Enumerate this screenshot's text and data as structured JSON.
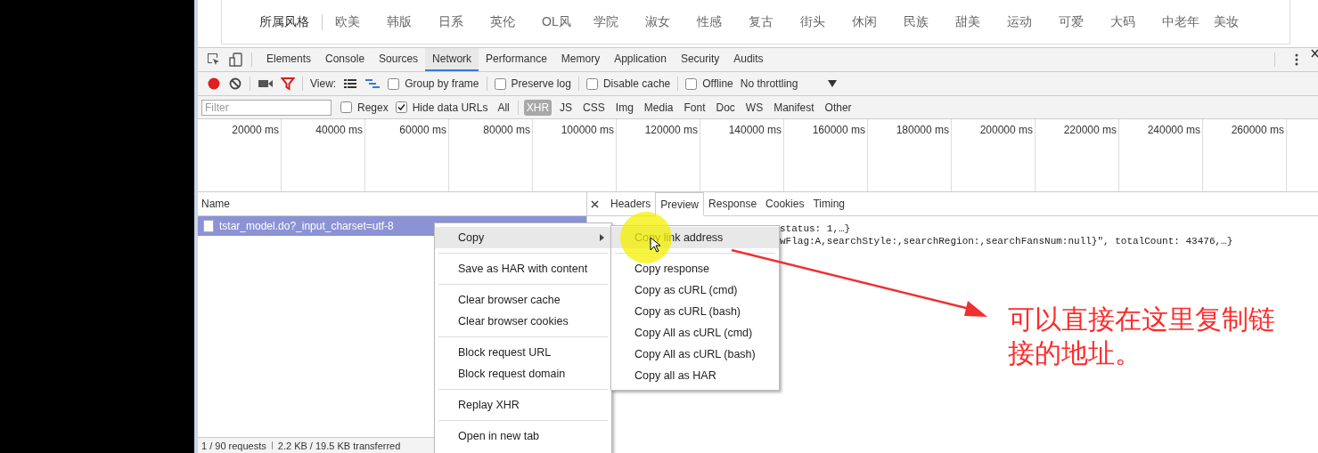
{
  "page_styles": {
    "label": "所属风格",
    "items": [
      "欧美",
      "韩版",
      "日系",
      "英伦",
      "OL风",
      "学院",
      "淑女",
      "性感",
      "复古",
      "街头",
      "休闲",
      "民族",
      "甜美",
      "运动",
      "可爱",
      "大码",
      "中老年",
      "美妆"
    ]
  },
  "devtools_tabs": [
    {
      "label": "Elements",
      "selected": false
    },
    {
      "label": "Console",
      "selected": false
    },
    {
      "label": "Sources",
      "selected": false
    },
    {
      "label": "Network",
      "selected": true
    },
    {
      "label": "Performance",
      "selected": false
    },
    {
      "label": "Memory",
      "selected": false
    },
    {
      "label": "Application",
      "selected": false
    },
    {
      "label": "Security",
      "selected": false
    },
    {
      "label": "Audits",
      "selected": false
    }
  ],
  "toolbar": {
    "recording": true,
    "view_label": "View:",
    "options": [
      {
        "label": "Group by frame",
        "checked": false
      },
      {
        "label": "Preserve log",
        "checked": false
      },
      {
        "label": "Disable cache",
        "checked": false
      },
      {
        "label": "Offline",
        "checked": false
      }
    ],
    "throttling": "No throttling"
  },
  "filter_bar": {
    "placeholder": "Filter",
    "regex": {
      "label": "Regex",
      "checked": false
    },
    "hide_data_urls": {
      "label": "Hide data URLs",
      "checked": true
    },
    "types": [
      {
        "label": "All",
        "selected": false
      },
      {
        "label": "XHR",
        "selected": true
      },
      {
        "label": "JS",
        "selected": false
      },
      {
        "label": "CSS",
        "selected": false
      },
      {
        "label": "Img",
        "selected": false
      },
      {
        "label": "Media",
        "selected": false
      },
      {
        "label": "Font",
        "selected": false
      },
      {
        "label": "Doc",
        "selected": false
      },
      {
        "label": "WS",
        "selected": false
      },
      {
        "label": "Manifest",
        "selected": false
      },
      {
        "label": "Other",
        "selected": false
      }
    ]
  },
  "timeline": {
    "ticks": [
      "20000 ms",
      "40000 ms",
      "60000 ms",
      "80000 ms",
      "100000 ms",
      "120000 ms",
      "140000 ms",
      "160000 ms",
      "180000 ms",
      "200000 ms",
      "220000 ms",
      "240000 ms",
      "260000 ms"
    ]
  },
  "requests": {
    "column": "Name",
    "rows": [
      {
        "name": "tstar_model.do?_input_charset=utf-8",
        "selected": true
      }
    ]
  },
  "status_bar": [
    "1 / 90 requests",
    "2.2 KB / 19.5 KB transferred"
  ],
  "detail_tabs": [
    {
      "label": "Headers",
      "selected": false
    },
    {
      "label": "Preview",
      "selected": true
    },
    {
      "label": "Response",
      "selected": false
    },
    {
      "label": "Cookies",
      "selected": false
    },
    {
      "label": "Timing",
      "selected": false
    }
  ],
  "preview_lines": [
    "status: 1,…}",
    "wFlag:A,searchStyle:,searchRegion:,searchFansNum:null}\", totalCount: 43476,…}"
  ],
  "context_menu": [
    [
      {
        "label": "Copy",
        "submenu": true,
        "highlighted": true
      }
    ],
    [
      {
        "label": "Save as HAR with content",
        "submenu": false,
        "highlighted": false
      }
    ],
    [
      {
        "label": "Clear browser cache",
        "submenu": false,
        "highlighted": false
      },
      {
        "label": "Clear browser cookies",
        "submenu": false,
        "highlighted": false
      }
    ],
    [
      {
        "label": "Block request URL",
        "submenu": false,
        "highlighted": false
      },
      {
        "label": "Block request domain",
        "submenu": false,
        "highlighted": false
      }
    ],
    [
      {
        "label": "Replay XHR",
        "submenu": false,
        "highlighted": false
      }
    ],
    [
      {
        "label": "Open in new tab",
        "submenu": false,
        "highlighted": false
      }
    ]
  ],
  "submenu": [
    [
      {
        "label": "Copy link address",
        "highlighted": true
      }
    ],
    [
      {
        "label": "Copy response",
        "highlighted": false
      },
      {
        "label": "Copy as cURL (cmd)",
        "highlighted": false
      },
      {
        "label": "Copy as cURL (bash)",
        "highlighted": false
      },
      {
        "label": "Copy All as cURL (cmd)",
        "highlighted": false
      },
      {
        "label": "Copy All as cURL (bash)",
        "highlighted": false
      },
      {
        "label": "Copy all as HAR",
        "highlighted": false
      }
    ]
  ],
  "annotation": "可以直接在这里复制链接的地址。"
}
